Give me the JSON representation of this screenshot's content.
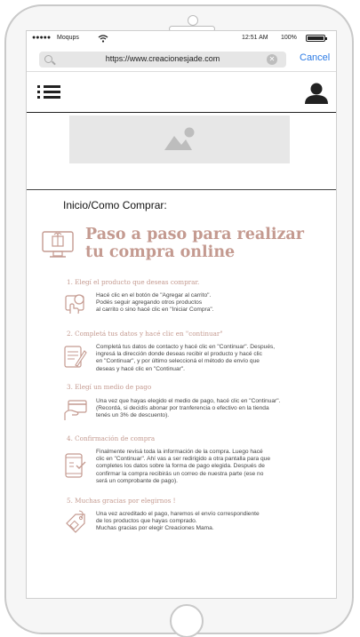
{
  "status": {
    "carrier": "Moqups",
    "time": "12:51 AM",
    "battery": "100%"
  },
  "browser": {
    "url": "https://www.creacionesjade.com",
    "cancel_label": "Cancel"
  },
  "breadcrumb": "Inicio/Como Comprar:",
  "heading": {
    "line1": "Paso a paso para realizar",
    "line2": "tu compra online"
  },
  "steps": [
    {
      "title": "1. Elegí el producto que deseas comprar.",
      "text": "Hacé clic en el botón de \"Agregar al carrito\".\nPodés seguir agregando otros productos\nal carrito o sino hacé clic en \"Iniciar Compra\".",
      "icon": "tap-product-icon"
    },
    {
      "title": "2. Completá tus datos y hacé clic en \"continuar\"",
      "text": "Completá tus datos de contacto y hacé clic en \"Continuar\". Después,\ningresá la dirección donde deseas recibir el  producto y hacé clic\nen \"Continuar\", y por último seleccioná el método de envío que\ndeseas y hacé clic en \"Continuar\".",
      "icon": "form-icon"
    },
    {
      "title": "3. Elegí un medio de pago",
      "text": "Una vez que hayas elegido el medio de pago, hacé clic en \"Continuar\".\n(Recordá, si decidís abonar por tranferencia o efectivo en la tienda\ntenés un 3% de descuento).",
      "icon": "card-payment-icon"
    },
    {
      "title": "4. Confirmación de compra",
      "text": "Finalmente revisá toda la información de la compra. Luego hacé\nclic en \"Continuar\". Ahí vas a ser redirigido a otra pantalla para que\ncompletes los datos sobre la forma de pago elegida. Después de\nconfirmar la compra recibirás un correo de nuestra parte (ese no\nserá un comprobante de pago).",
      "icon": "phone-check-icon"
    },
    {
      "title": "5. Muchas gracias por elegirnos !",
      "text": "Una vez acreditado el pago, haremos el envío correspondiente\nde los productos que hayas comprado.\nMuchas gracias por elegir Creaciones Mama.",
      "icon": "gift-tag-icon"
    }
  ],
  "colors": {
    "accent": "#c49a90",
    "link": "#2c7be5"
  }
}
